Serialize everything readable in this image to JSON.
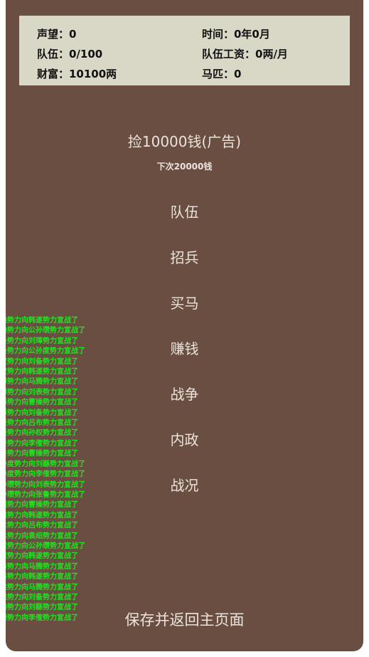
{
  "stats": {
    "reputation": "声望：0",
    "time": "时间：0年0月",
    "troops": "队伍：0/100",
    "wages": "队伍工资：0两/月",
    "wealth": "财富：10100两",
    "horses": "马匹：0"
  },
  "ad_button": {
    "label": "捡10000钱(广告)",
    "next_note": "下次20000钱"
  },
  "menu": [
    "队伍",
    "招兵",
    "买马",
    "赚钱",
    "战争",
    "内政",
    "战况"
  ],
  "log": [
    "操势力向韩遂势力宣战了",
    "操势力向公孙瓒势力宣战了",
    "备势力向刘璋势力宣战了",
    "备势力向公孙度势力宣战了",
    "权势力向刘备势力宣战了",
    "权势力向韩遂势力宣战了",
    "璋势力向马腾势力宣战了",
    "璋势力向刘表势力宣战了",
    "繇势力向曹操势力宣战了",
    "繇势力向刘备势力宣战了",
    "表势力向吕布势力宣战了",
    "表势力向孙权势力宣战了",
    "鲁势力向李傕势力宣战了",
    "鲁势力向曹操势力宣战了",
    "孙度势力向刘繇势力宣战了",
    "孙度势力向李傕势力宣战了",
    "孙瓒势力向刘表势力宣战了",
    "孙瓒势力向张鲁势力宣战了",
    "绍势力向曹操势力宣战了",
    "绍势力向韩遂势力宣战了",
    "术势力向吕布势力宣战了",
    "术势力向袁绍势力宣战了",
    "傕势力向公孙瓒势力宣战了",
    "傕势力向韩遂势力宣战了",
    "布势力向马腾势力宣战了",
    "布势力向韩遂势力宣战了",
    "遂势力向马腾势力宣战了",
    "遂势力向刘备势力宣战了",
    "腾势力向刘繇势力宣战了",
    "腾势力向李傕势力宣战了"
  ],
  "save_button": "保存并返回主页面"
}
